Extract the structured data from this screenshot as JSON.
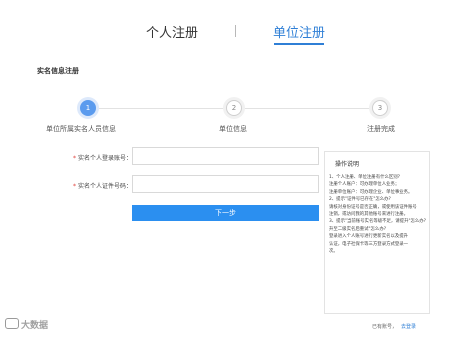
{
  "tabs": [
    {
      "label": "个人注册",
      "active": false
    },
    {
      "label": "单位注册",
      "active": true
    }
  ],
  "section_title": "实名信息注册",
  "steps": [
    {
      "number": "1",
      "label": "单位所属实名人员信息",
      "state": "active"
    },
    {
      "number": "2",
      "label": "单位信息",
      "state": "pending"
    },
    {
      "number": "3",
      "label": "注册完成",
      "state": "pending"
    }
  ],
  "form": {
    "required_mark": "*",
    "login_label": "实名个人登录账号：",
    "login_value": "",
    "id_label": "实名个人证件号码：",
    "id_value": "",
    "next_button": "下一步"
  },
  "help": {
    "title": "操作说明",
    "lines": [
      "1、个人注册、单位注册有什么区别?",
      "注册个人账户：可办理单位人业务；",
      "注册单位账户：可办理企业、单位事业务。",
      "2、提示\"证件号已存在\"怎么办?",
      "请核对身份证号是否正确，或使用该证件账号",
      "注销，或访问我的其他账号来进行注册。",
      "3、提示\"当前账号实名等级不足，请提升\"怎么办?",
      "升至二级实名后重试\"怎么办?",
      "登录进入个人账号进行更新实名以及提升",
      "认证，电子社保卡等三方登录方式登录一",
      "次。"
    ]
  },
  "footer": {
    "text": "已有账号，",
    "link": "去登录"
  },
  "watermark": "大数据",
  "colors": {
    "accent": "#2f7fd6",
    "button": "#2b8ff0",
    "step_active": "#5b9bee",
    "required": "#e0403a"
  }
}
